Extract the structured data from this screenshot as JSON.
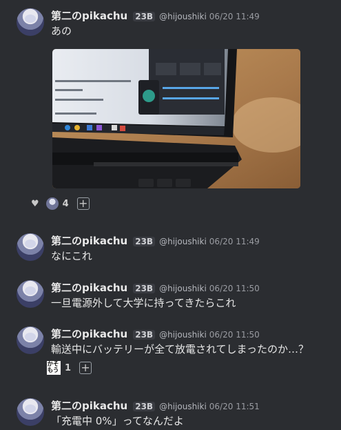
{
  "messages": [
    {
      "author": "第二のpikachu",
      "tag": "23B",
      "handle": "@hijoushiki",
      "time": "06/20 11:49",
      "text": "あの",
      "reactions": [
        {
          "icon": "avatar-reaction-icon",
          "count": "4"
        }
      ]
    },
    {
      "author": "第二のpikachu",
      "tag": "23B",
      "handle": "@hijoushiki",
      "time": "06/20 11:49",
      "text": "なにこれ"
    },
    {
      "author": "第二のpikachu",
      "tag": "23B",
      "handle": "@hijoushiki",
      "time": "06/20 11:50",
      "text": "一旦電源外して大学に持ってきたらこれ"
    },
    {
      "author": "第二のpikachu",
      "tag": "23B",
      "handle": "@hijoushiki",
      "time": "06/20 11:50",
      "text": "輸送中にバッテリーが全て放電されてしまったのか…？",
      "reactions": [
        {
          "icon": "kaso-stamp-icon",
          "stamp_text": "かそもう",
          "count": "1"
        }
      ]
    },
    {
      "author": "第二のpikachu",
      "tag": "23B",
      "handle": "@hijoushiki",
      "time": "06/20 11:51",
      "text": "「充電中 0%」ってなんだよ"
    }
  ],
  "colors": {
    "background": "#2b2d31",
    "text": "#e6e6e6",
    "muted": "#9a9ca2"
  }
}
